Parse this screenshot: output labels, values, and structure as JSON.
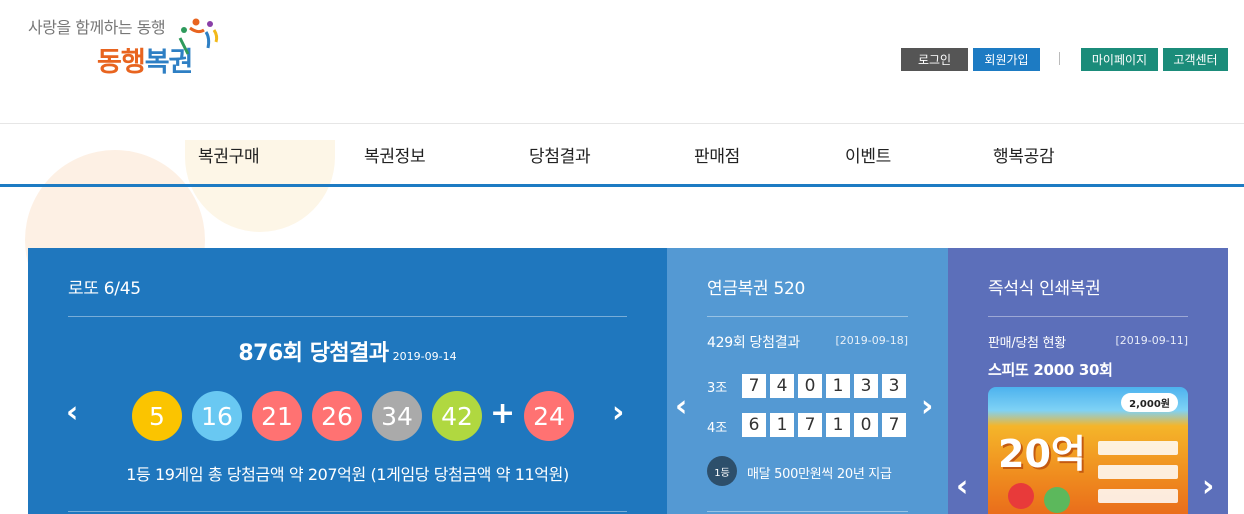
{
  "header": {
    "tagline": "사랑을 함께하는 동행",
    "logo_part1": "동행",
    "logo_part2": "복권",
    "buttons": {
      "login": "로그인",
      "join": "회원가입",
      "sep": "|",
      "mypage": "마이페이지",
      "cs": "고객센터"
    }
  },
  "nav": {
    "items": [
      "복권구매",
      "복권정보",
      "당첨결과",
      "판매점",
      "이벤트",
      "행복공감"
    ]
  },
  "lotto": {
    "title": "로또 6/45",
    "round_text": "876회 당첨결과",
    "date": "2019-09-14",
    "numbers": [
      "5",
      "16",
      "21",
      "26",
      "34",
      "42"
    ],
    "plus": "+",
    "bonus": "24",
    "summary": "1등 19게임 총 당첨금액 약 207억원 (1게임당 당첨금액 약 11억원)"
  },
  "pension": {
    "title": "연금복권 520",
    "round_text": "429회 당첨결과",
    "date": "[2019-09-18]",
    "groups": [
      {
        "label": "3조",
        "digits": [
          "7",
          "4",
          "0",
          "1",
          "3",
          "3"
        ]
      },
      {
        "label": "4조",
        "digits": [
          "6",
          "1",
          "7",
          "1",
          "0",
          "7"
        ]
      }
    ],
    "rank": "1등",
    "prize": "매달 500만원씩 20년 지급"
  },
  "instant": {
    "title": "즉석식 인쇄복권",
    "status": "판매/당첨 현황",
    "date": "[2019-09-11]",
    "name": "스피또 2000 30회",
    "ticket_price": "2,000원",
    "ticket_big": "20억"
  },
  "arrows": {
    "prev": "‹",
    "next": "›"
  },
  "colors": {
    "lotto_bg": "#1f77be",
    "pension_bg": "#5499d3",
    "instant_bg": "#5c6fba",
    "ball_yellow": "#fbc400",
    "ball_blue": "#69c8f2",
    "ball_red": "#ff7272",
    "ball_gray": "#aaaaaa",
    "ball_green": "#b0d840"
  }
}
